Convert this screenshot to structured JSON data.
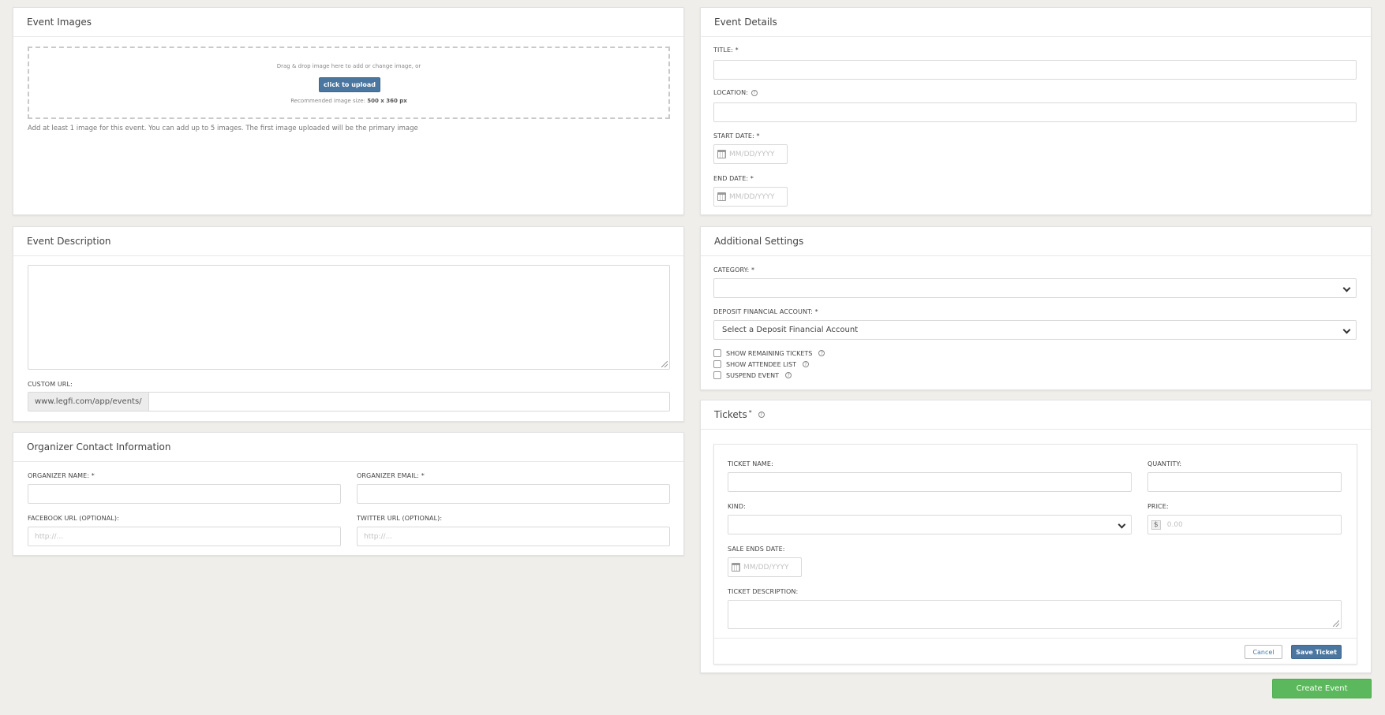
{
  "event_images": {
    "title": "Event Images",
    "drop_text": "Drag & drop image here to add or change image, or",
    "upload_label": "click to upload",
    "recommended_prefix": "Recommended image size:",
    "recommended_size": "500 x 360 px",
    "helper": "Add at least 1 image for this event. You can add up to 5 images. The first image uploaded will be the primary image"
  },
  "event_details": {
    "title": "Event Details",
    "title_label": "TITLE: *",
    "location_label": "LOCATION:",
    "start_date_label": "START DATE: *",
    "start_date_placeholder": "MM/DD/YYYY",
    "end_date_label": "END DATE: *",
    "end_date_placeholder": "MM/DD/YYYY"
  },
  "event_description": {
    "title": "Event Description",
    "custom_url_label": "CUSTOM URL:",
    "url_prefix": "www.legfi.com/app/events/"
  },
  "additional_settings": {
    "title": "Additional Settings",
    "category_label": "CATEGORY: *",
    "category_value": "",
    "deposit_label": "DEPOSIT FINANCIAL ACCOUNT: *",
    "deposit_value": "Select a Deposit Financial Account",
    "checkboxes": [
      {
        "label": "SHOW REMAINING TICKETS"
      },
      {
        "label": "SHOW ATTENDEE LIST"
      },
      {
        "label": "SUSPEND EVENT"
      }
    ]
  },
  "organizer": {
    "title": "Organizer Contact Information",
    "name_label": "ORGANIZER NAME: *",
    "email_label": "ORGANIZER EMAIL: *",
    "facebook_label": "FACEBOOK URL (OPTIONAL):",
    "facebook_placeholder": "http://...",
    "twitter_label": "TWITTER URL (OPTIONAL):",
    "twitter_placeholder": "http://..."
  },
  "tickets": {
    "title": "Tickets",
    "required_mark": "*",
    "ticket_name_label": "TICKET NAME:",
    "quantity_label": "QUANTITY:",
    "kind_label": "KIND:",
    "price_label": "PRICE:",
    "currency_symbol": "$",
    "price_placeholder": "0.00",
    "sale_ends_label": "SALE ENDS DATE:",
    "sale_ends_placeholder": "MM/DD/YYYY",
    "description_label": "TICKET DESCRIPTION:",
    "cancel_label": "Cancel",
    "save_label": "Save Ticket"
  },
  "create_event_label": "Create Event",
  "help_icon_glyph": "?",
  "icons": [
    "help-icon",
    "calendar-icon",
    "chevron-down-icon",
    "resize-handle-icon"
  ],
  "colors": {
    "primary": "#4a76a0",
    "success": "#5cb85c",
    "background": "#efeeeb"
  }
}
